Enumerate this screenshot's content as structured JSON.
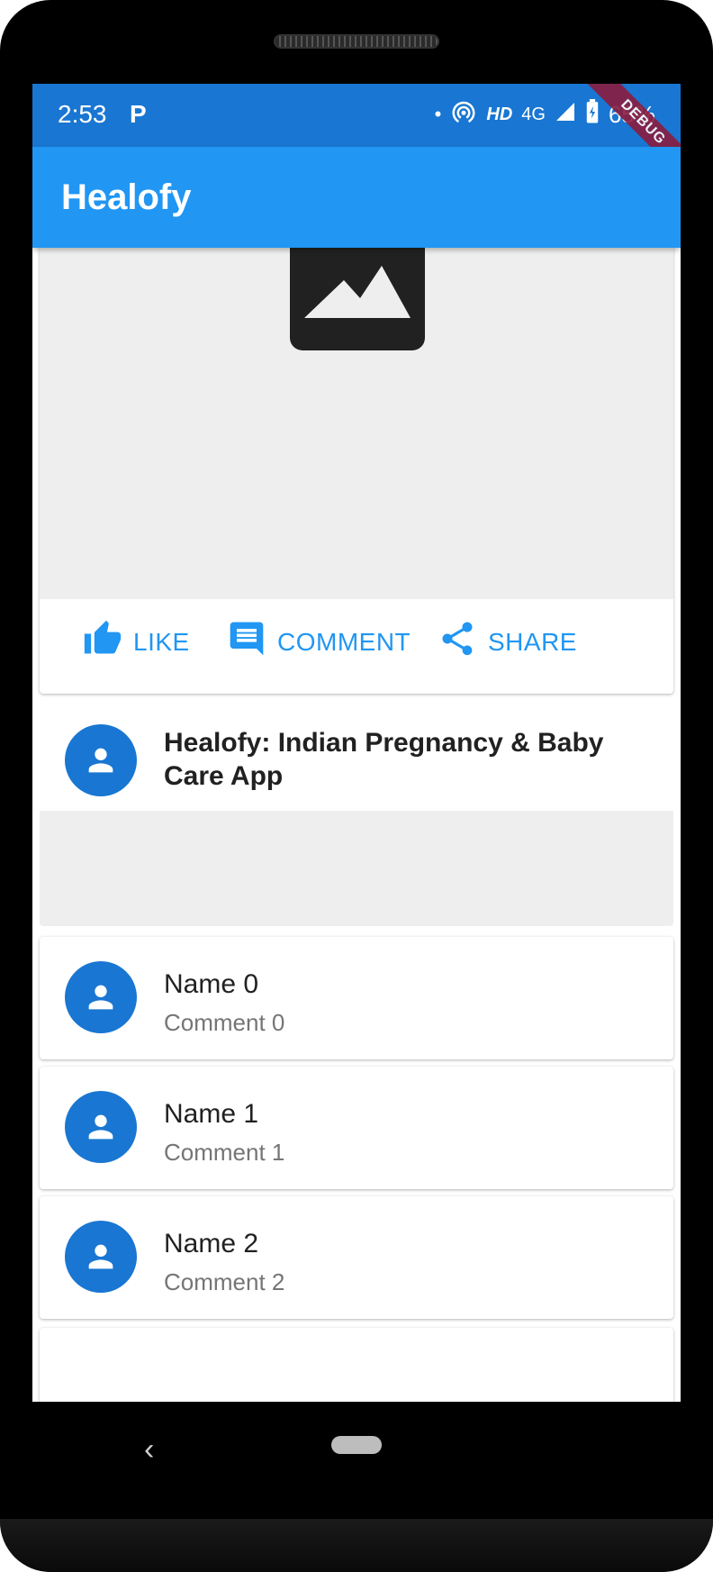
{
  "status_bar": {
    "time": "2:53",
    "app_indicator": "P",
    "dot": "•",
    "hd": "HD",
    "network": "4G",
    "battery": "65%",
    "icons": [
      "hotspot-icon",
      "signal-icon",
      "battery-charging-icon"
    ]
  },
  "debug_banner": "DEBUG",
  "app_bar": {
    "title": "Healofy"
  },
  "hero_post": {
    "image_icon": "image-placeholder-icon",
    "actions": [
      {
        "label": "LIKE",
        "icon": "thumb-up-icon"
      },
      {
        "label": "COMMENT",
        "icon": "comment-icon"
      },
      {
        "label": "SHARE",
        "icon": "share-icon"
      }
    ]
  },
  "post": {
    "title": "Healofy: Indian Pregnancy & Baby Care App",
    "avatar_icon": "person-icon"
  },
  "comments": [
    {
      "name": "Name 0",
      "comment": "Comment 0"
    },
    {
      "name": "Name 1",
      "comment": "Comment 1"
    },
    {
      "name": "Name 2",
      "comment": "Comment 2"
    }
  ],
  "nav": {
    "back": "‹"
  },
  "colors": {
    "primary": "#2196f3",
    "status_bar": "#1976d2",
    "avatar": "#1976d2",
    "placeholder_bg": "#eeeeee"
  }
}
